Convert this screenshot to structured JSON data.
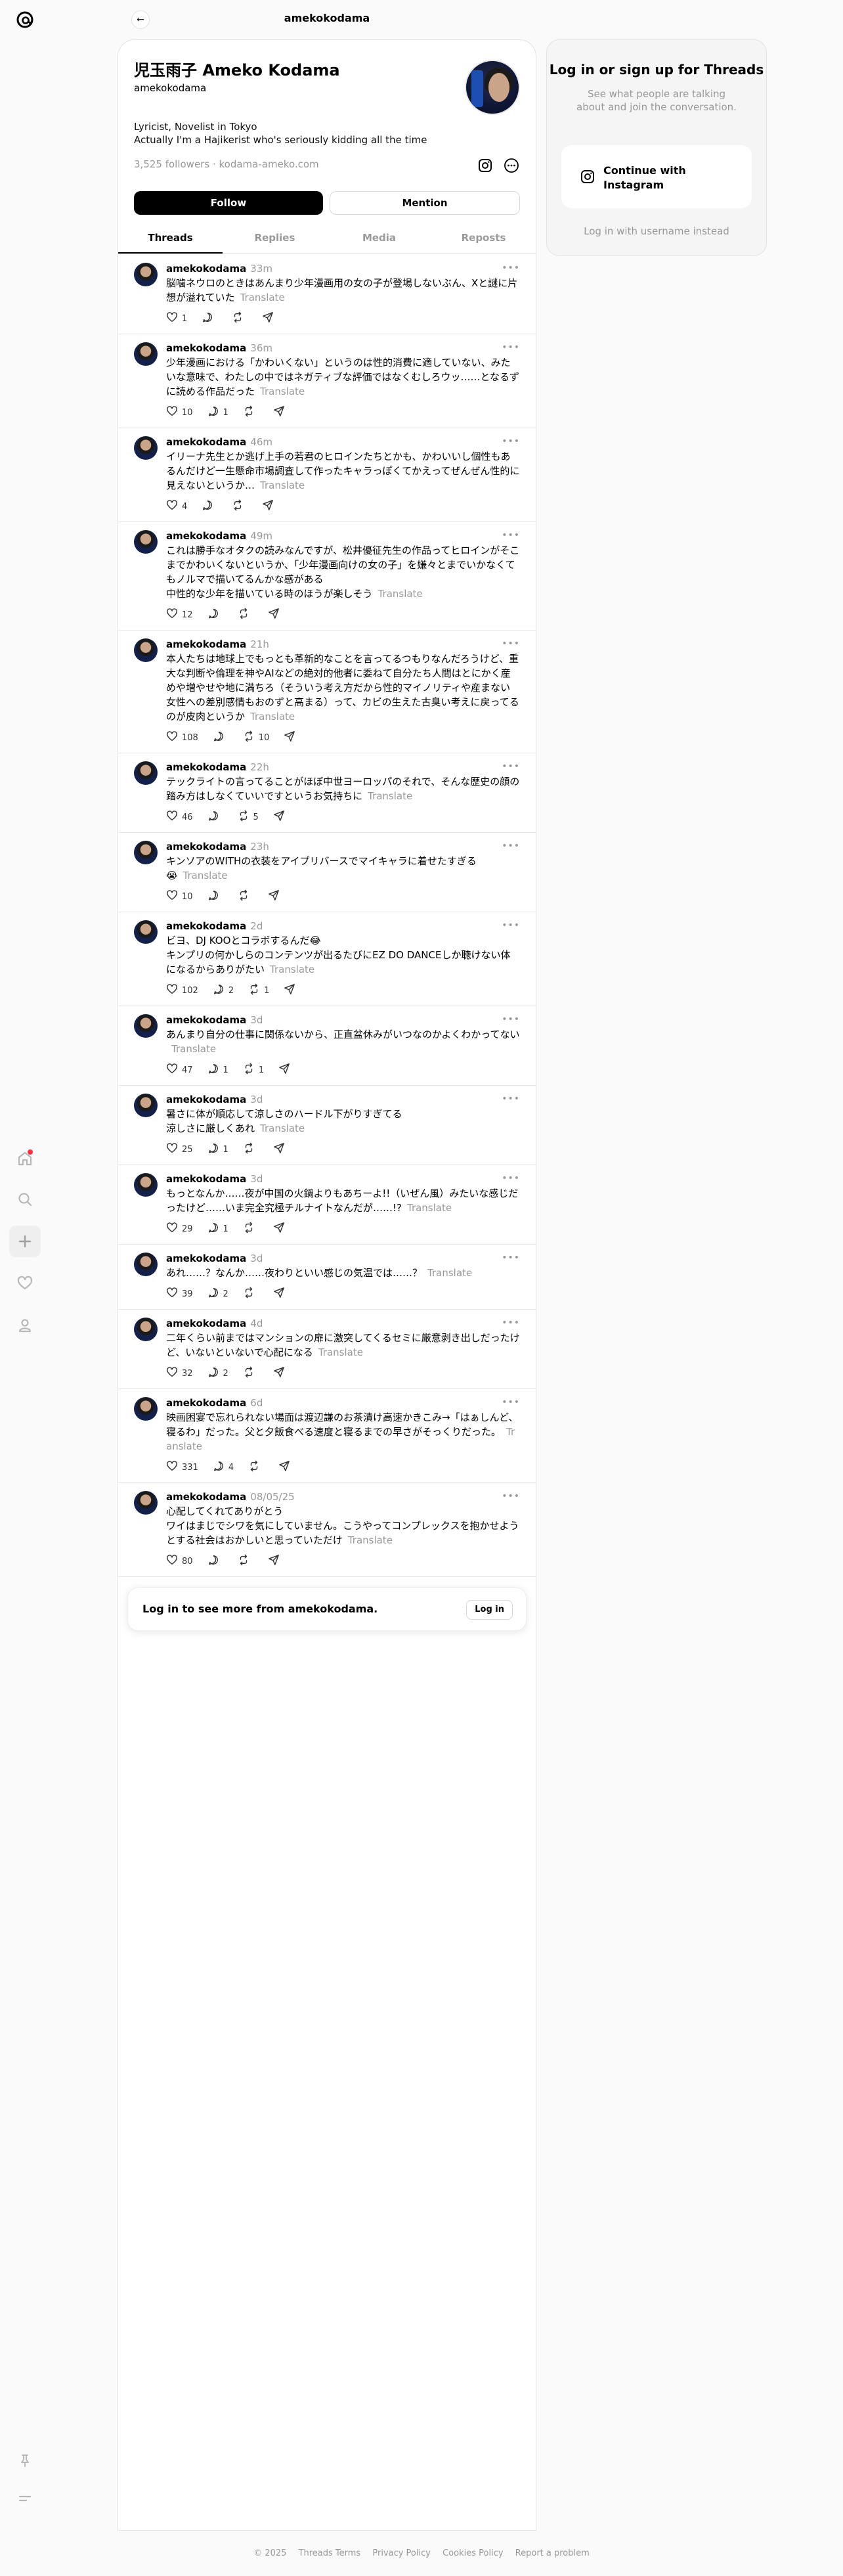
{
  "header": {
    "title": "amekokodama"
  },
  "profile": {
    "name": "児玉雨子 Ameko Kodama",
    "handle": "amekokodama",
    "bio_line1": "Lyricist, Novelist in Tokyo",
    "bio_line2": "Actually I'm a Hajikerist who's seriously kidding all the time",
    "followers": "3,525 followers",
    "link": "kodama-ameko.com",
    "follow_label": "Follow",
    "mention_label": "Mention"
  },
  "tabs": [
    "Threads",
    "Replies",
    "Media",
    "Reposts"
  ],
  "translate_label": "Translate",
  "posts": [
    {
      "user": "amekokodama",
      "time": "33m",
      "text": "脳噛ネウロのときはあんまり少年漫画用の女の子が登場しないぶん、Xと謎に片想が溢れていた",
      "likes": "1",
      "replies": "",
      "reposts": ""
    },
    {
      "user": "amekokodama",
      "time": "36m",
      "text": "少年漫画における「かわいくない」というのは性的消費に適していない、みたいな意味で、わたしの中ではネガティブな評価ではなくむしろウッ……となるずに読める作品だった",
      "likes": "10",
      "replies": "1",
      "reposts": ""
    },
    {
      "user": "amekokodama",
      "time": "46m",
      "text": "イリーナ先生とか逃げ上手の若君のヒロインたちとかも、かわいいし個性もあるんだけど一生懸命市場調査して作ったキャラっぽくてかえってぜんぜん性的に見えないというか…",
      "likes": "4",
      "replies": "",
      "reposts": ""
    },
    {
      "user": "amekokodama",
      "time": "49m",
      "text": "これは勝手なオタクの読みなんですが、松井優征先生の作品ってヒロインがそこまでかわいくないというか、「少年漫画向けの女の子」を嫌々とまでいかなくてもノルマで描いてるんかな感がある\n中性的な少年を描いている時のほうが楽しそう",
      "likes": "12",
      "replies": "",
      "reposts": ""
    },
    {
      "user": "amekokodama",
      "time": "21h",
      "text": "本人たちは地球上でもっとも革新的なことを言ってるつもりなんだろうけど、重大な判断や倫理を神やAIなどの絶対的他者に委ねて自分たち人間はとにかく産めや増やせや地に満ちろ（そういう考え方だから性的マイノリティや産まない女性への差別感情もおのずと高まる）って、カビの生えた古臭い考えに戻ってるのが皮肉というか",
      "likes": "108",
      "replies": "",
      "reposts": "10"
    },
    {
      "user": "amekokodama",
      "time": "22h",
      "text": "テックライトの言ってることがほぼ中世ヨーロッパのそれで、そんな歴史の顔の踏み方はしなくていいですというお気持ちに",
      "likes": "46",
      "replies": "",
      "reposts": "5"
    },
    {
      "user": "amekokodama",
      "time": "23h",
      "text": "キンソアのWITHの衣装をアイプリバースでマイキャラに着せたすぎる\n😭",
      "likes": "10",
      "replies": "",
      "reposts": ""
    },
    {
      "user": "amekokodama",
      "time": "2d",
      "text": "ビヨ、DJ KOOとコラボするんだ😂\nキンプリの何かしらのコンテンツが出るたびにEZ DO DANCEしか聴けない体になるからありがたい",
      "likes": "102",
      "replies": "2",
      "reposts": "1"
    },
    {
      "user": "amekokodama",
      "time": "3d",
      "text": "あんまり自分の仕事に関係ないから、正直盆休みがいつなのかよくわかってない",
      "likes": "47",
      "replies": "1",
      "reposts": "1"
    },
    {
      "user": "amekokodama",
      "time": "3d",
      "text": "暑さに体が順応して涼しさのハードル下がりすぎてる\n涼しさに厳しくあれ",
      "likes": "25",
      "replies": "1",
      "reposts": ""
    },
    {
      "user": "amekokodama",
      "time": "3d",
      "text": "もっとなんか……夜が中国の火鍋よりもあちーよ!!（いぜん風）みたいな感じだったけど……いま完全究極チルナイトなんだが……!?",
      "likes": "29",
      "replies": "1",
      "reposts": ""
    },
    {
      "user": "amekokodama",
      "time": "3d",
      "text": "あれ……？なんか……夜わりといい感じの気温では……？",
      "likes": "39",
      "replies": "2",
      "reposts": ""
    },
    {
      "user": "amekokodama",
      "time": "4d",
      "text": "二年くらい前まではマンションの扉に激突してくるセミに厳意剥き出しだったけど、いないといないで心配になる",
      "likes": "32",
      "replies": "2",
      "reposts": ""
    },
    {
      "user": "amekokodama",
      "time": "6d",
      "text": "映画困宴で忘れられない場面は渡辺謙のお茶漬け高速かきこみ→「はぁしんど、寝るわ」だった。父と夕飯食べる速度と寝るまでの早さがそっくりだった。",
      "likes": "331",
      "replies": "4",
      "reposts": ""
    },
    {
      "user": "amekokodama",
      "time": "08/05/25",
      "text": "心配してくれてありがとう\nワイはまじでシワを気にしていません。こうやってコンプレックスを抱かせようとする社会はおかしいと思っていただけ",
      "likes": "80",
      "replies": "",
      "reposts": ""
    }
  ],
  "login_more": {
    "text": "Log in to see more from amekokodama.",
    "button": "Log in"
  },
  "side": {
    "title": "Log in or sign up for Threads",
    "subtitle": "See what people are talking about and join the conversation.",
    "instagram_label": "Continue with Instagram",
    "alt_label": "Log in with username instead"
  },
  "footer": [
    "© 2025",
    "Threads Terms",
    "Privacy Policy",
    "Cookies Policy",
    "Report a problem"
  ]
}
